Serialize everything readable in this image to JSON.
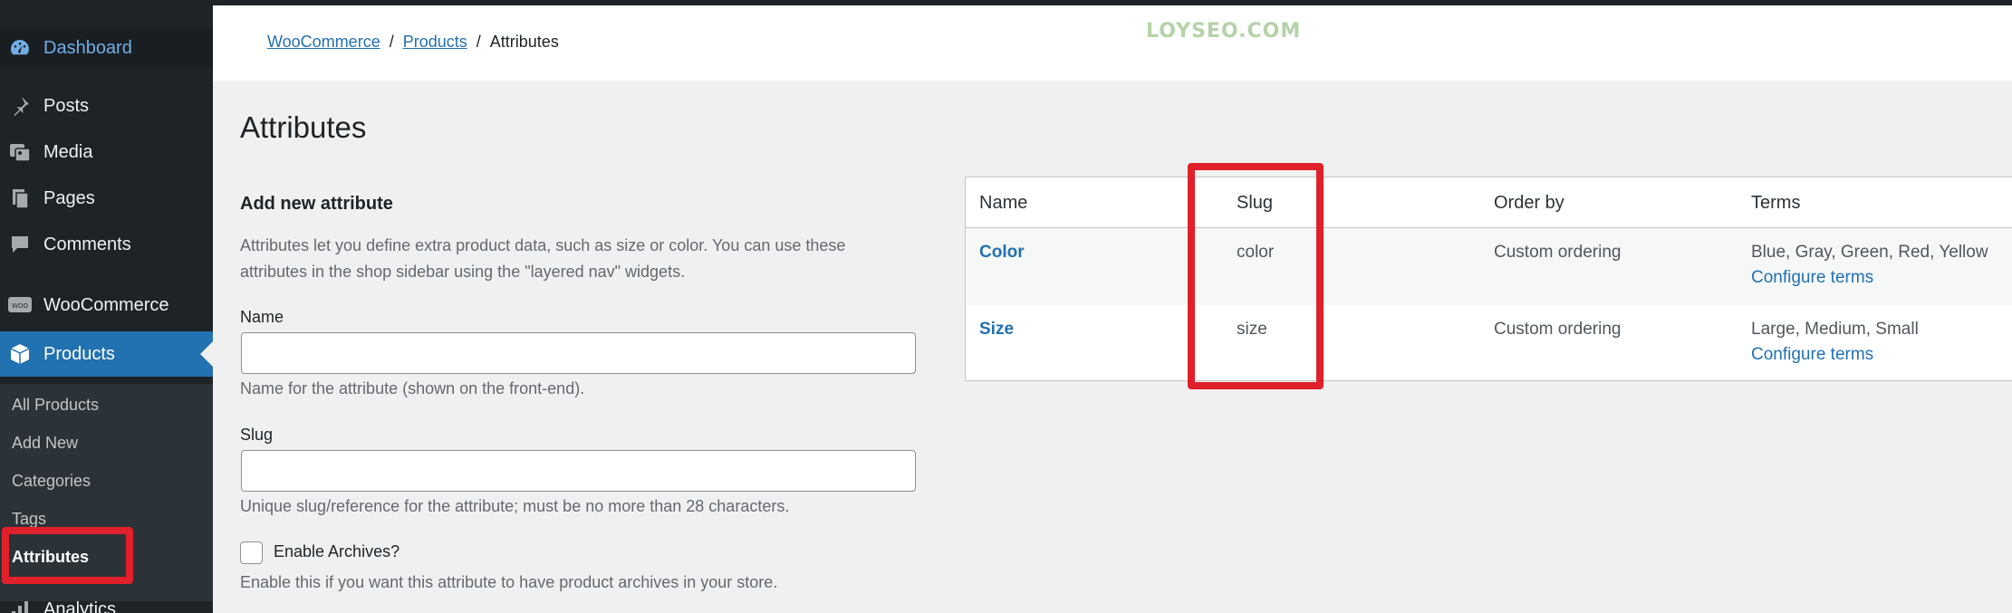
{
  "sidebar": {
    "dashboard": "Dashboard",
    "posts": "Posts",
    "media": "Media",
    "pages": "Pages",
    "comments": "Comments",
    "woocommerce": "WooCommerce",
    "products": "Products",
    "submenu": [
      "All Products",
      "Add New",
      "Categories",
      "Tags",
      "Attributes"
    ],
    "analytics": "Analytics"
  },
  "header": {
    "breadcrumb": [
      "WooCommerce",
      "Products",
      "Attributes"
    ],
    "separator": "/",
    "watermark": "LOYSEO.COM"
  },
  "page": {
    "title": "Attributes"
  },
  "form": {
    "title": "Add new attribute",
    "description": "Attributes let you define extra product data, such as size or color. You can use these attributes in the shop sidebar using the \"layered nav\" widgets.",
    "name_label": "Name",
    "name_value": "",
    "name_hint": "Name for the attribute (shown on the front-end).",
    "slug_label": "Slug",
    "slug_value": "",
    "slug_hint": "Unique slug/reference for the attribute; must be no more than 28 characters.",
    "archives_label": "Enable Archives?",
    "archives_hint": "Enable this if you want this attribute to have product archives in your store."
  },
  "table": {
    "columns": [
      "Name",
      "Slug",
      "Order by",
      "Terms"
    ],
    "rows": [
      {
        "name": "Color",
        "slug": "color",
        "order_by": "Custom ordering",
        "terms": "Blue, Gray, Green, Red, Yellow",
        "configure": "Configure terms"
      },
      {
        "name": "Size",
        "slug": "size",
        "order_by": "Custom ordering",
        "terms": "Large, Medium, Small",
        "configure": "Configure terms"
      }
    ]
  },
  "colors": {
    "admin_bar": "#1d2327",
    "accent": "#2271b1",
    "highlight": "#e0202a"
  },
  "icons": [
    "dashboard-icon",
    "pin-icon",
    "media-icon",
    "pages-icon",
    "comments-icon",
    "woo-icon",
    "products-icon",
    "analytics-icon"
  ]
}
